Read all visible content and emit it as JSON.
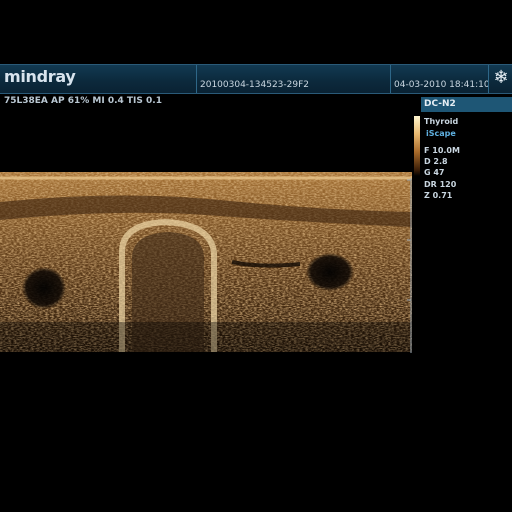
{
  "header": {
    "brand": "mindray",
    "patient_id": "20100304-134523-29F2",
    "datetime": "04-03-2010  18:41:10",
    "freeze_icon": "snowflake-icon"
  },
  "scan": {
    "params": "75L38EA  AP 61%  MI 0.4  TIS 0.1"
  },
  "side_panel": {
    "mode": "DC-N2",
    "preset": "Thyroid",
    "iscape": "iScape",
    "frequency": "F 10.0M",
    "depth": "D 2.8",
    "gain": "G 47",
    "dynamic_range": "DR 120",
    "zoom": "Z 0.71"
  },
  "colors": {
    "header_bg": "#0c2a3d",
    "mode_label_bg": "#1e5675",
    "iscape_text": "#5fb0e0",
    "image_tint": "#b07a3a"
  }
}
